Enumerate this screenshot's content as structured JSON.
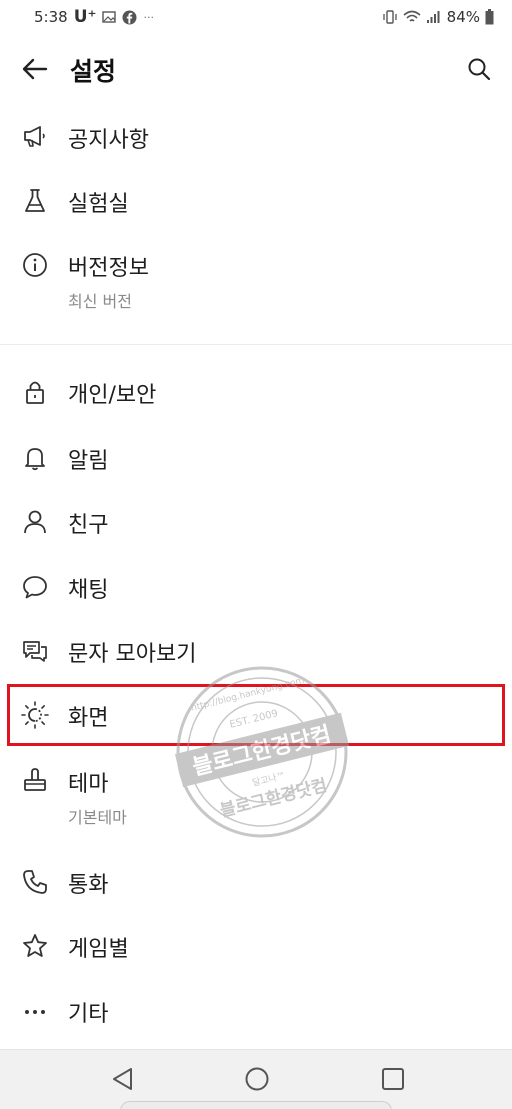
{
  "status_bar": {
    "time": "5:38",
    "carrier": "U⁺",
    "more": "···",
    "battery": "84%"
  },
  "header": {
    "title": "설정"
  },
  "menu": {
    "notice": {
      "label": "공지사항",
      "icon": "megaphone-icon"
    },
    "lab": {
      "label": "실험실",
      "icon": "flask-icon"
    },
    "version": {
      "label": "버전정보",
      "sub": "최신 버전",
      "icon": "info-icon"
    },
    "privacy": {
      "label": "개인/보안",
      "icon": "lock-icon"
    },
    "alarm": {
      "label": "알림",
      "icon": "bell-icon"
    },
    "friends": {
      "label": "친구",
      "icon": "person-icon"
    },
    "chat": {
      "label": "채팅",
      "icon": "chat-bubble-icon"
    },
    "sms": {
      "label": "문자 모아보기",
      "icon": "messages-icon"
    },
    "display": {
      "label": "화면",
      "icon": "brightness-icon"
    },
    "theme": {
      "label": "테마",
      "sub": "기본테마",
      "icon": "brush-icon"
    },
    "call": {
      "label": "통화",
      "icon": "phone-icon"
    },
    "game": {
      "label": "게임별",
      "icon": "star-icon"
    },
    "etc": {
      "label": "기타",
      "icon": "more-dots-icon"
    }
  },
  "watermark": {
    "main": "블로그한경닷컴",
    "est": "EST. 2009",
    "sub": "달고나™",
    "url": "http://blog.hankyung.com"
  },
  "colors": {
    "highlight": "#e0141e",
    "text": "#1e1e1e",
    "subtext": "#8a8a8a"
  }
}
